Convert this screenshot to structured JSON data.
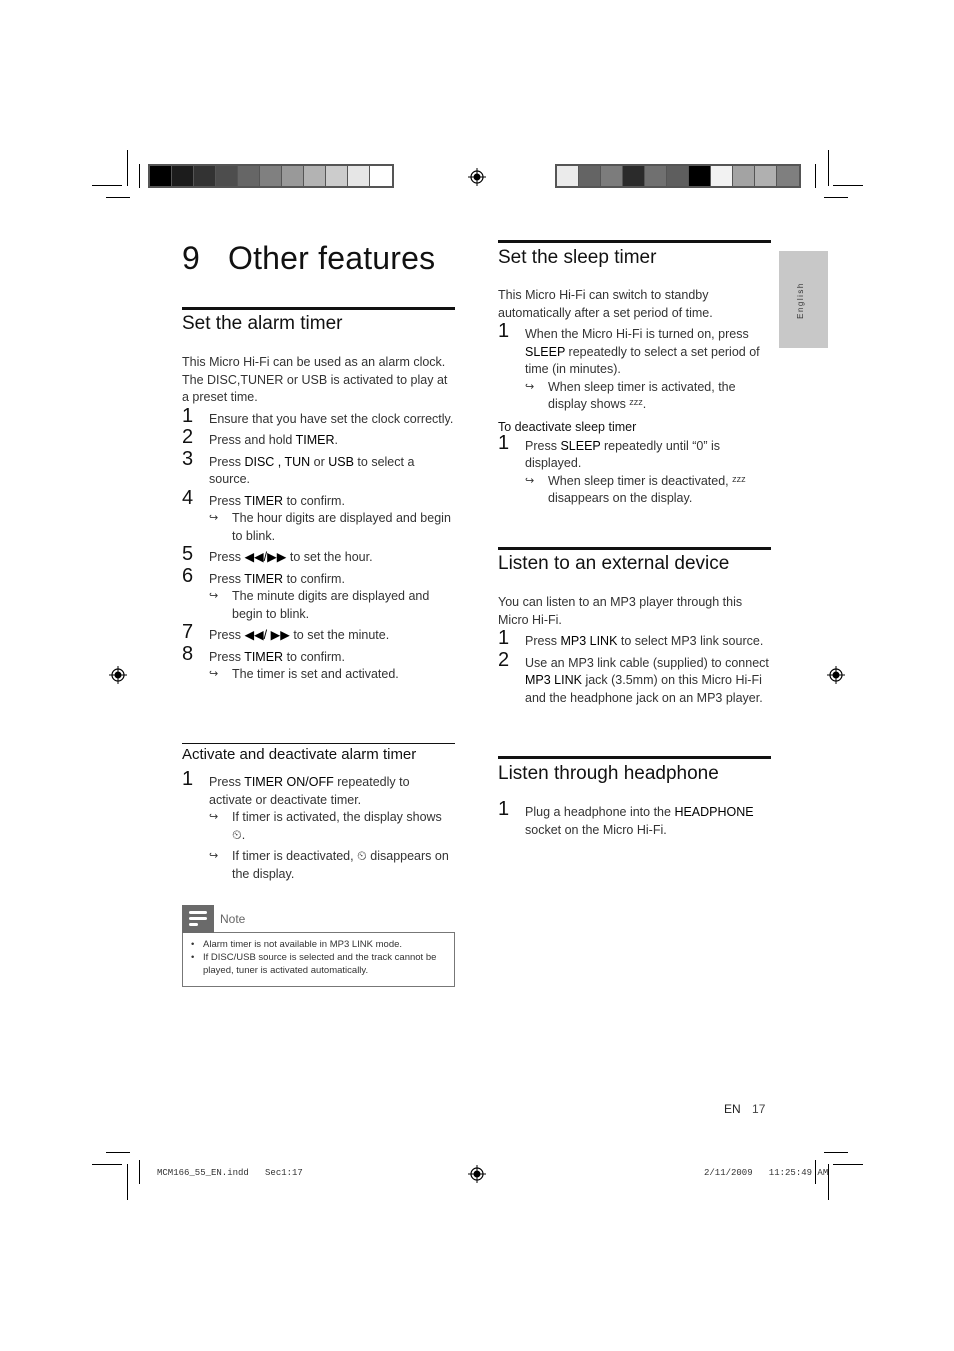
{
  "print_marks": {
    "left_colorbar": [
      "#000000",
      "#1c1c1c",
      "#333333",
      "#4d4d4d",
      "#666666",
      "#808080",
      "#999999",
      "#b3b3b3",
      "#cccccc",
      "#e6e6e6",
      "#ffffff"
    ],
    "right_colorbar": [
      "#ebebeb",
      "#646464",
      "#7c7c7c",
      "#2b2b2b",
      "#707070",
      "#5e5e5e",
      "#000000",
      "#f2f2f2",
      "#a3a3a3",
      "#b0b0b0",
      "#7f7f7f"
    ],
    "slug_file": "MCM166_55_EN.indd   Sec1:17",
    "slug_date": "2/11/2009   11:25:49 AM"
  },
  "language_tab": "English",
  "chapter": {
    "number": "9",
    "title": "Other features"
  },
  "alarm": {
    "title": "Set the alarm timer",
    "intro": "This Micro Hi-Fi can be used as an alarm clock. The DISC,TUNER or USB is activated to play at a preset time.",
    "steps": [
      {
        "n": "1",
        "pre": "Ensure that you have set the clock correctly.",
        "bold": "",
        "post": ""
      },
      {
        "n": "2",
        "pre": "Press and hold ",
        "bold": "TIMER",
        "post": "."
      },
      {
        "n": "3",
        "pre": "Press ",
        "bold": "DISC , TUN",
        "mid": " or ",
        "bold2": "USB",
        "post": " to select a source."
      },
      {
        "n": "4",
        "pre": "Press ",
        "bold": "TIMER",
        "post": " to confirm.",
        "result": "The hour digits are displayed and begin to blink."
      },
      {
        "n": "5",
        "pre": "Press ",
        "bold": "◀◀/▶▶",
        "post": " to set the hour."
      },
      {
        "n": "6",
        "pre": "Press ",
        "bold": "TIMER",
        "post": " to confirm.",
        "result": "The minute digits are displayed and begin to blink."
      },
      {
        "n": "7",
        "pre": "Press ",
        "bold": "◀◀/ ▶▶",
        "post": " to set the minute."
      },
      {
        "n": "8",
        "pre": "Press ",
        "bold": "TIMER",
        "post": " to confirm.",
        "result": "The timer is set and activated."
      }
    ],
    "sub_title": "Activate and deactivate alarm timer",
    "sub_step": {
      "n": "1",
      "pre": "Press ",
      "bold": "TIMER ON/OFF",
      "post": " repeatedly to activate or deactivate timer."
    },
    "sub_results": [
      "If timer is activated, the display shows ⏲.",
      "If timer is deactivated, ⏲ disappears on the display."
    ],
    "note": {
      "label": "Note",
      "items": [
        "Alarm timer is not available in MP3 LINK mode.",
        "If DISC/USB source is selected and the track cannot be played, tuner is activated automatically."
      ]
    }
  },
  "sleep": {
    "title": "Set the sleep timer",
    "intro": "This Micro Hi-Fi can switch to standby automatically after a set period of time.",
    "step": {
      "n": "1",
      "pre": "When the Micro Hi-Fi is turned on, press ",
      "bold": "SLEEP",
      "post": " repeatedly to select a set period of time (in minutes).",
      "result": "When sleep timer is activated, the display shows ᶻᶻᶻ."
    },
    "deactivate_title": "To deactivate sleep timer",
    "deactivate_step": {
      "n": "1",
      "pre": "Press ",
      "bold": "SLEEP",
      "post": " repeatedly until “0” is displayed.",
      "result": "When sleep timer is deactivated, ᶻᶻᶻ disappears on the display."
    }
  },
  "external": {
    "title": "Listen to an external device",
    "intro": "You can listen to an MP3 player through this Micro Hi-Fi.",
    "steps": [
      {
        "n": "1",
        "pre": "Press ",
        "bold": "MP3 LINK",
        "post": " to select MP3 link source."
      },
      {
        "n": "2",
        "pre": "Use an MP3 link cable (supplied) to connect ",
        "bold": "MP3 LINK",
        "post": " jack (3.5mm) on this Micro Hi-Fi and the headphone jack on an MP3 player."
      }
    ]
  },
  "headphone": {
    "title": "Listen through headphone",
    "step": {
      "n": "1",
      "pre": "Plug a headphone into the ",
      "bold": "HEADPHONE",
      "post": " socket on the Micro Hi-Fi."
    }
  },
  "footer": {
    "lang": "EN",
    "page": "17"
  }
}
